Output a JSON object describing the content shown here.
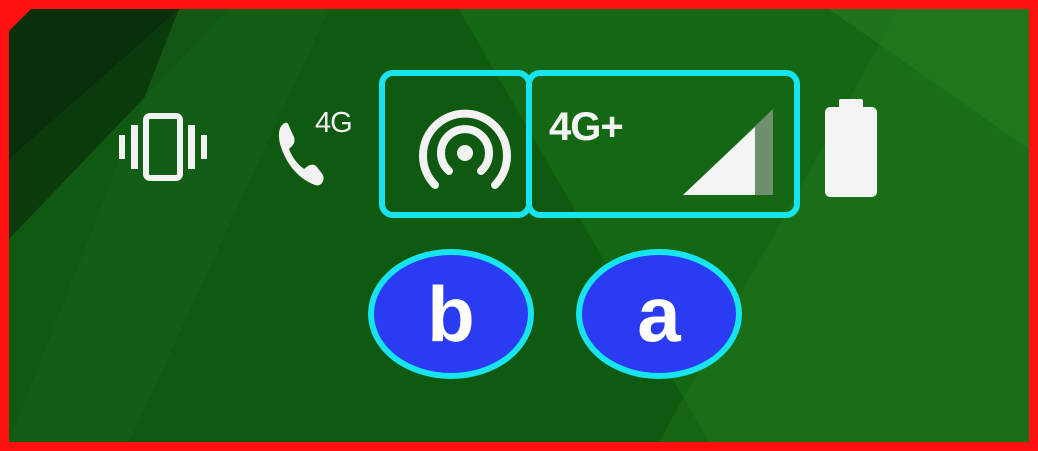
{
  "status_bar": {
    "vibrate_icon": "vibrate-icon",
    "call_icon": "phone-call-icon",
    "call_network_label": "4G",
    "hotspot_icon": "hotspot-icon",
    "network_label": "4G+",
    "signal_icon": "signal-strength-icon",
    "battery_icon": "battery-icon"
  },
  "annotations": {
    "marker_b": "b",
    "marker_a": "a",
    "highlight_color": "#17e4ee",
    "marker_color": "#2b3bf2",
    "frame_color": "#ff1010"
  }
}
